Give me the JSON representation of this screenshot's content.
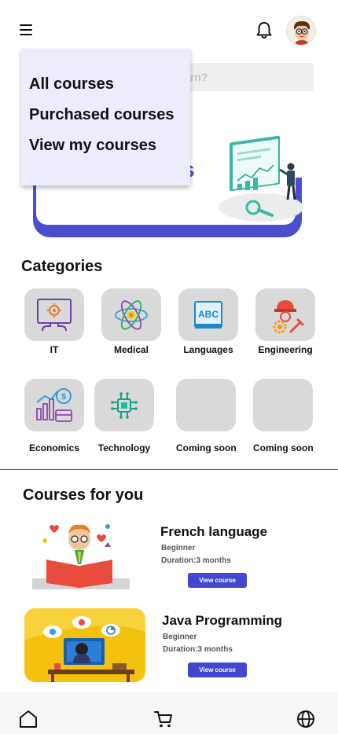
{
  "header": {
    "menu_icon": "hamburger-menu-icon",
    "notification_icon": "bell-icon",
    "avatar_icon": "user-avatar"
  },
  "search": {
    "placeholder": "What do you want to learn?",
    "visible_text": "arn?"
  },
  "banner": {
    "text_visible": "es"
  },
  "dropdown": {
    "items": [
      "All courses",
      "Purchased courses",
      "View my courses"
    ]
  },
  "categories": {
    "title": "Categories",
    "items": [
      {
        "label": "IT",
        "icon": "computer-gear-icon"
      },
      {
        "label": "Medical",
        "icon": "atom-icon"
      },
      {
        "label": "Languages",
        "icon": "abc-book-icon"
      },
      {
        "label": "Engineering",
        "icon": "engineer-gear-icon"
      },
      {
        "label": "Economics",
        "icon": "economics-chart-icon"
      },
      {
        "label": "Technology",
        "icon": "chip-icon"
      },
      {
        "label": "Coming soon",
        "icon": ""
      },
      {
        "label": "Coming soon",
        "icon": ""
      }
    ]
  },
  "courses": {
    "title": "Courses for you",
    "items": [
      {
        "title": "French language",
        "level": "Beginner",
        "duration": "Duration:3 months",
        "button": "View course"
      },
      {
        "title": "Java Programming",
        "level": "Beginner",
        "duration": "Duration:3 months",
        "button": "View course"
      }
    ]
  },
  "bottom_nav": {
    "items": [
      "home-icon",
      "cart-icon",
      "globe-icon"
    ]
  },
  "colors": {
    "accent": "#4a4fd0",
    "tile": "#d9d9d9",
    "dropdown_bg": "#ececfd"
  }
}
